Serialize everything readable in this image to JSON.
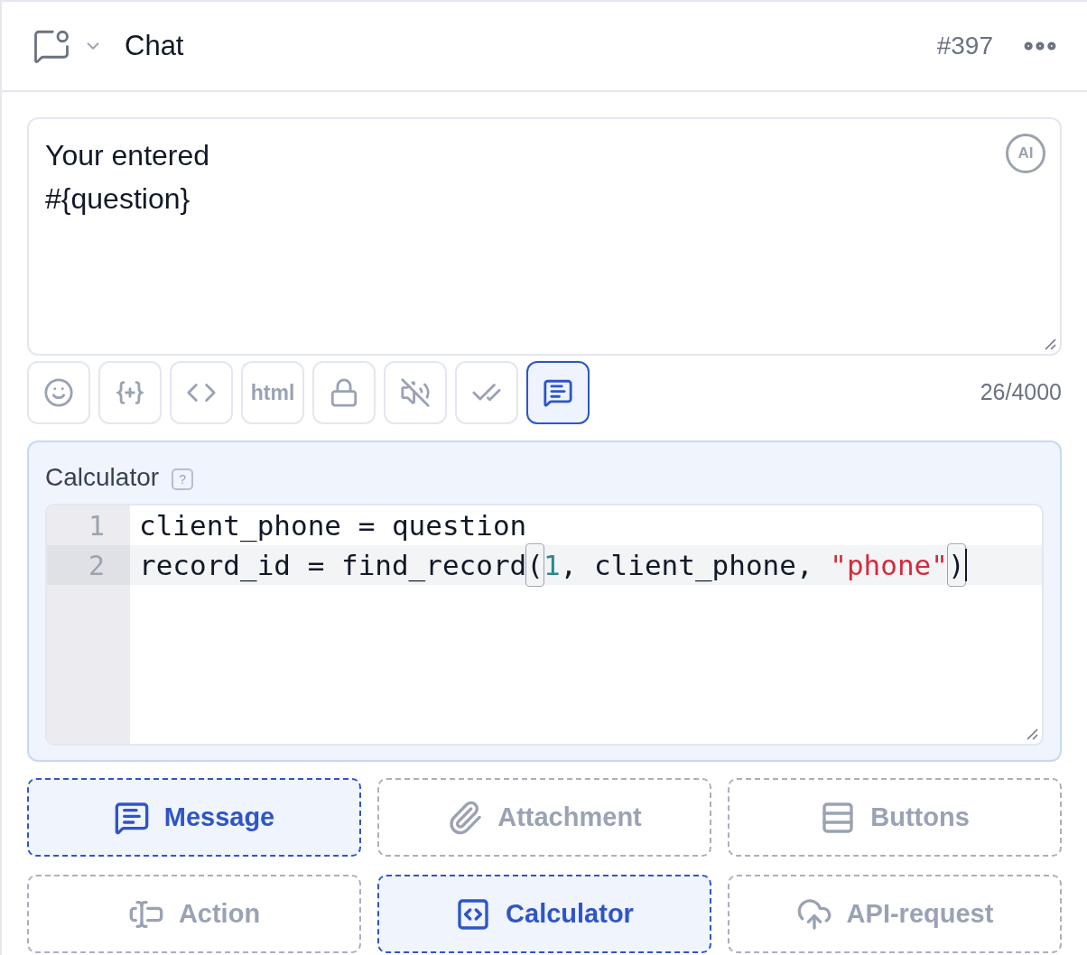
{
  "header": {
    "title": "Chat",
    "number": "#397"
  },
  "message": {
    "value": "Your entered\n#{question}",
    "ai_badge": "AI"
  },
  "toolbar": [
    {
      "kind": "emoji",
      "selected": false
    },
    {
      "kind": "variable",
      "selected": false
    },
    {
      "kind": "code",
      "selected": false
    },
    {
      "kind": "html",
      "label": "html",
      "selected": false
    },
    {
      "kind": "lock",
      "selected": false
    },
    {
      "kind": "mute",
      "selected": false
    },
    {
      "kind": "read",
      "selected": false
    },
    {
      "kind": "message",
      "selected": true
    }
  ],
  "counter": "26/4000",
  "calculator": {
    "label": "Calculator",
    "help": "?",
    "lines": [
      {
        "number": "1",
        "selected": false,
        "tokens": [
          {
            "kind": "plain",
            "text": "client_phone = question"
          }
        ]
      },
      {
        "number": "2",
        "selected": true,
        "tokens": [
          {
            "kind": "plain",
            "text": "record_id = find_record"
          },
          {
            "kind": "bracket",
            "text": "("
          },
          {
            "kind": "number",
            "text": "1"
          },
          {
            "kind": "plain",
            "text": ", client_phone, "
          },
          {
            "kind": "string",
            "text": "\"phone\""
          },
          {
            "kind": "bracket",
            "text": ")"
          }
        ]
      }
    ]
  },
  "blocks": [
    {
      "kind": "message",
      "label": "Message",
      "selected": true
    },
    {
      "kind": "attachment",
      "label": "Attachment",
      "selected": false
    },
    {
      "kind": "buttons",
      "label": "Buttons",
      "selected": false
    },
    {
      "kind": "action",
      "label": "Action",
      "selected": false
    },
    {
      "kind": "calculator",
      "label": "Calculator",
      "selected": true
    },
    {
      "kind": "api",
      "label": "API-request",
      "selected": false
    }
  ]
}
